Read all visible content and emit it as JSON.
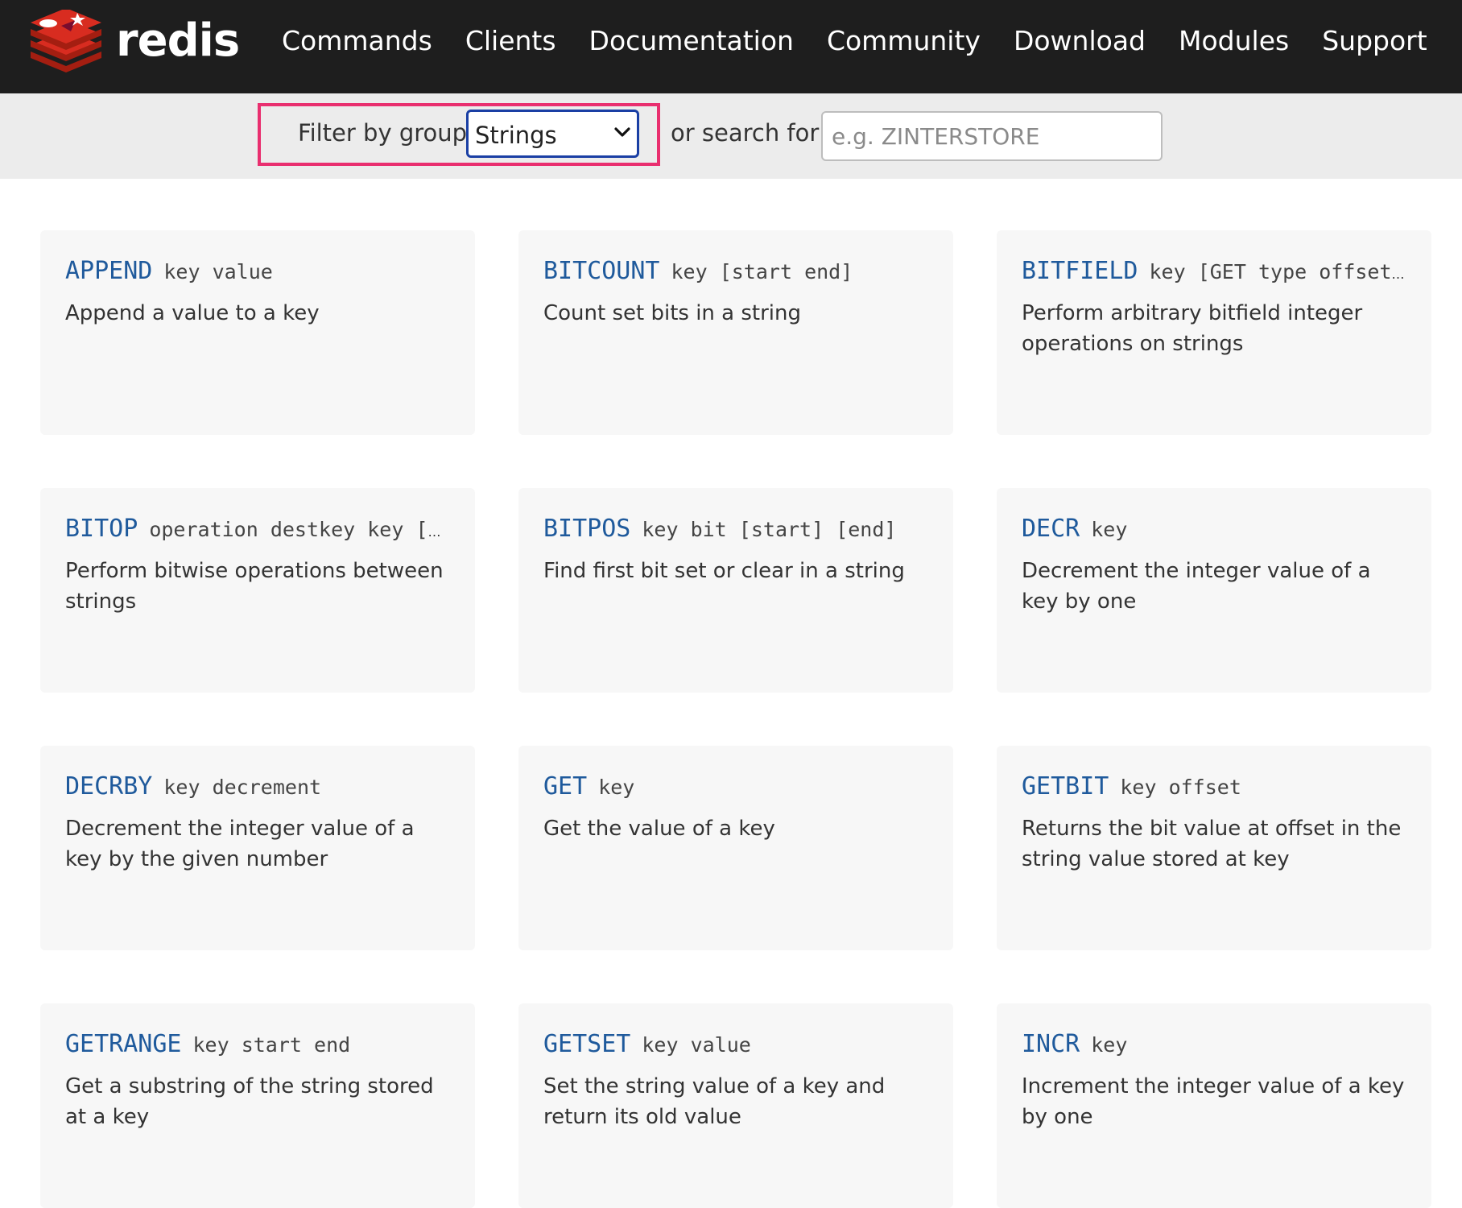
{
  "header": {
    "logo_text": "redis",
    "nav": [
      "Commands",
      "Clients",
      "Documentation",
      "Community",
      "Download",
      "Modules",
      "Support"
    ]
  },
  "filter": {
    "group_label": "Filter by group:",
    "group_selected": "Strings",
    "search_label": "or search for:",
    "search_placeholder": "e.g. ZINTERSTORE",
    "highlight_color": "#e92f6f"
  },
  "colors": {
    "command_name": "#1f5a9c",
    "topbar_bg": "#1e1e1e",
    "logo_red": "#d82c20"
  },
  "commands": [
    {
      "name": "APPEND",
      "args": "key value",
      "summary": "Append a value to a key"
    },
    {
      "name": "BITCOUNT",
      "args": "key [start end]",
      "summary": "Count set bits in a string"
    },
    {
      "name": "BITFIELD",
      "args": "key [GET type offset]…",
      "summary": "Perform arbitrary bitfield integer operations on strings"
    },
    {
      "name": "BITOP",
      "args": "operation destkey key [k…",
      "summary": "Perform bitwise operations between strings"
    },
    {
      "name": "BITPOS",
      "args": "key bit [start] [end]",
      "summary": "Find first bit set or clear in a string"
    },
    {
      "name": "DECR",
      "args": "key",
      "summary": "Decrement the integer value of a key by one"
    },
    {
      "name": "DECRBY",
      "args": "key decrement",
      "summary": "Decrement the integer value of a key by the given number"
    },
    {
      "name": "GET",
      "args": "key",
      "summary": "Get the value of a key"
    },
    {
      "name": "GETBIT",
      "args": "key offset",
      "summary": "Returns the bit value at offset in the string value stored at key"
    },
    {
      "name": "GETRANGE",
      "args": "key start end",
      "summary": "Get a substring of the string stored at a key"
    },
    {
      "name": "GETSET",
      "args": "key value",
      "summary": "Set the string value of a key and return its old value"
    },
    {
      "name": "INCR",
      "args": "key",
      "summary": "Increment the integer value of a key by one"
    }
  ]
}
